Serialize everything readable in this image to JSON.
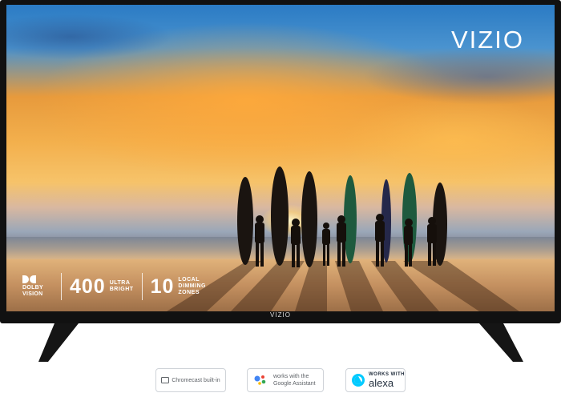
{
  "brand": {
    "logo_text": "VIZIO",
    "bezel_text": "VIZIO"
  },
  "features": {
    "dolby": {
      "line1": "DOLBY",
      "line2": "VISION"
    },
    "brightness": {
      "value": "400",
      "line1": "ULTRA",
      "line2": "BRIGHT"
    },
    "dimming": {
      "value": "10",
      "line1": "LOCAL",
      "line2": "DIMMING",
      "line3": "ZONES"
    }
  },
  "badges": {
    "chromecast": "Chromecast built-in",
    "google_assistant": {
      "line1": "works with the",
      "line2": "Google Assistant"
    },
    "alexa": {
      "line1": "WORKS WITH",
      "line2": "alexa"
    }
  },
  "colors": {
    "bezel": "#111111",
    "google_blue": "#4285f4",
    "google_red": "#ea4335",
    "google_yellow": "#fbbc05",
    "google_green": "#34a853",
    "alexa_blue": "#00caff"
  }
}
